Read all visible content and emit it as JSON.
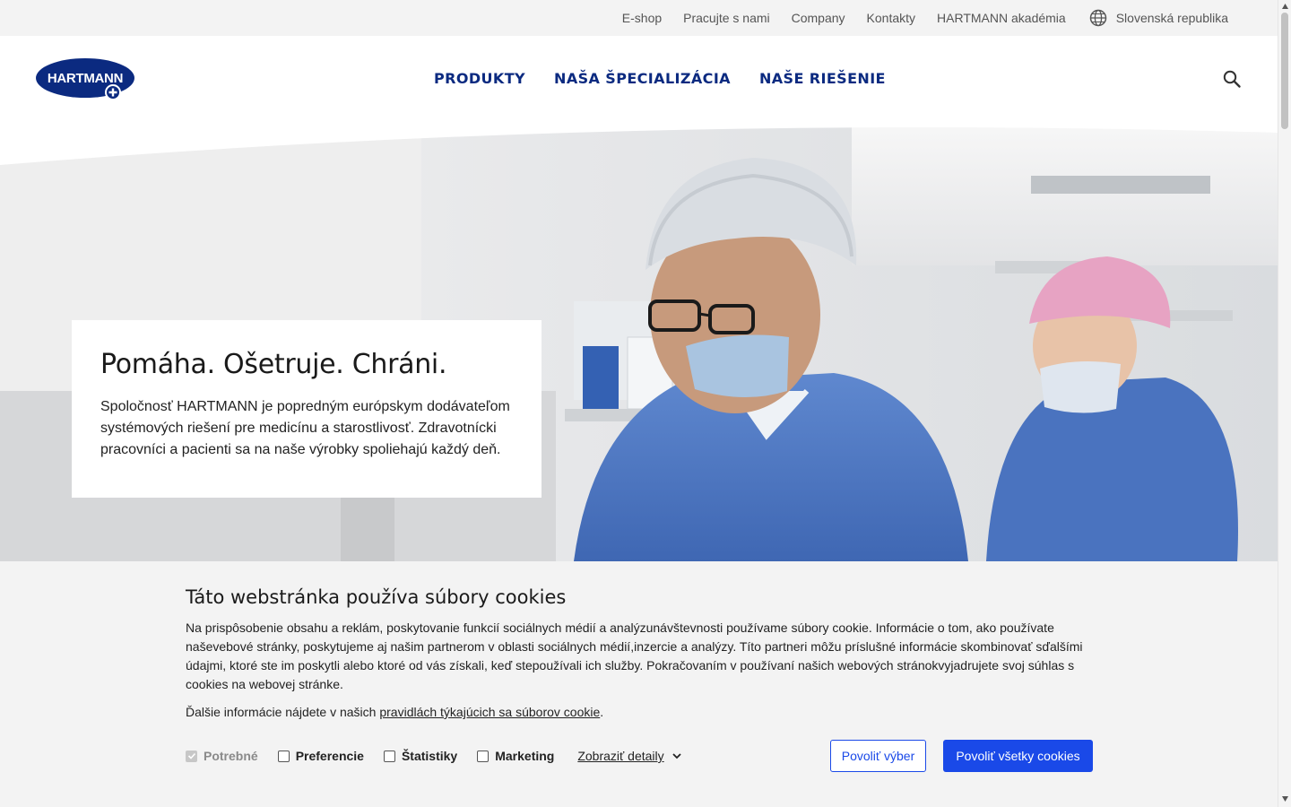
{
  "topbar": {
    "links": [
      "E-shop",
      "Pracujte s nami",
      "Company",
      "Kontakty",
      "HARTMANN akadémia"
    ],
    "language": "Slovenská republika",
    "language_icon": "globe-icon"
  },
  "header": {
    "logo_text": "HARTMANN",
    "nav": [
      "PRODUKTY",
      "NAŠA ŠPECIALIZÁCIA",
      "NAŠE RIEŠENIE"
    ],
    "search_icon": "search-icon",
    "brand_color": "#0b2a80"
  },
  "hero": {
    "title": "Pomáha. Ošetruje. Chráni.",
    "text": "Spoločnosť HARTMANN je popredným európskym dodávateľom systémových riešení pre medicínu a starostlivosť. Zdravotnícki pracovníci a pacienti sa na naše výrobky spoliehajú každý deň."
  },
  "cookie": {
    "title": "Táto webstránka používa súbory cookies",
    "body": "Na prispôsobenie obsahu a reklám, poskytovanie funkcií sociálnych médií a analýzunávštevnosti používame súbory cookie. Informácie o tom, ako používate naševebové stránky, poskytujeme aj našim partnerom v oblasti sociálnych médií,inzercie a analýzy. Títo partneri môžu príslušné informácie skombinovať sďalšími údajmi, ktoré ste im poskytli alebo ktoré od vás získali, keď stepoužívali ich služby. Pokračovaním v používaní našich webových stránokvyjadrujete svoj súhlas s cookies na webovej stránke.",
    "more_prefix": "Ďalšie informácie nájdete v našich ",
    "more_link": "pravidlách týkajúcich sa súborov cookie",
    "more_suffix": ".",
    "checkboxes": [
      {
        "label": "Potrebné",
        "checked": true,
        "disabled": true
      },
      {
        "label": "Preferencie",
        "checked": false,
        "disabled": false
      },
      {
        "label": "Štatistiky",
        "checked": false,
        "disabled": false
      },
      {
        "label": "Marketing",
        "checked": false,
        "disabled": false
      }
    ],
    "details_label": "Zobraziť detaily",
    "allow_selection": "Povoliť výber",
    "allow_all": "Povoliť všetky cookies",
    "accent_color": "#1a49e8"
  }
}
